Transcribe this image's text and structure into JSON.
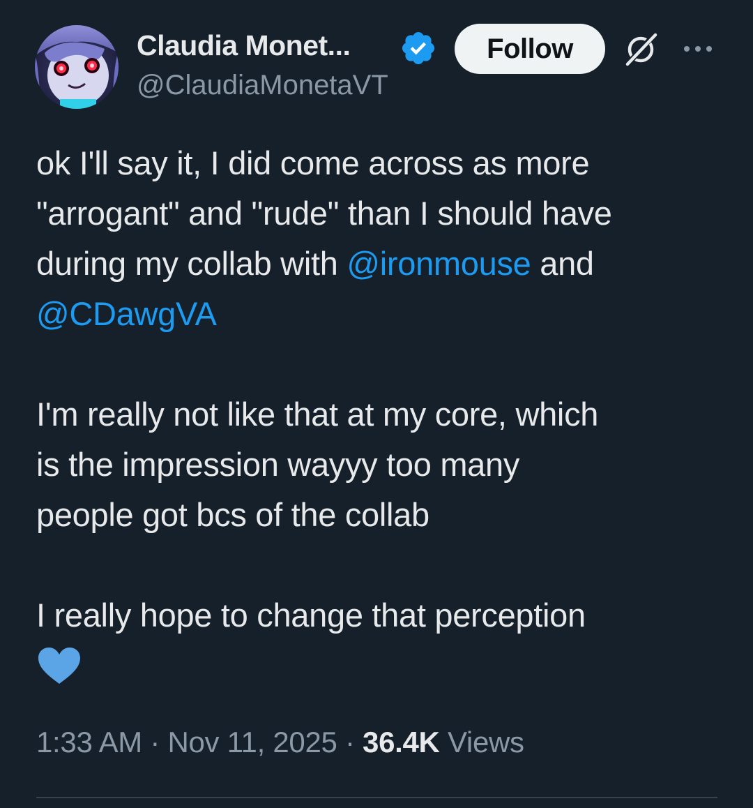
{
  "author": {
    "display_name": "Claudia Monet...",
    "handle": "@ClaudiaMonetaVT",
    "verified": true
  },
  "actions": {
    "follow_label": "Follow",
    "grok_icon": "grok-icon",
    "more_icon": "more-options-icon"
  },
  "tweet": {
    "lines": [
      "ok I'll say it, I did come across as more",
      "\"arrogant\" and \"rude\" than I should have",
      "during my collab with ",
      "@ironmouse",
      " and",
      "@CDawgVA",
      "I'm really not like that at my core, which",
      "is the impression wayyy too many",
      "people got bcs of the collab",
      "I really hope to change that perception"
    ],
    "emoji": "blue-heart"
  },
  "meta": {
    "time": "1:33 AM",
    "separator1": " · ",
    "date": "Nov 11, 2025",
    "separator2": " · ",
    "views_count": "36.4K",
    "views_label": " Views"
  },
  "colors": {
    "background": "#15202b",
    "text": "#e7e9ea",
    "secondary": "#8b98a5",
    "link": "#1d9bf0",
    "verified": "#1d9bf0",
    "heart": "#5ba4e6"
  }
}
